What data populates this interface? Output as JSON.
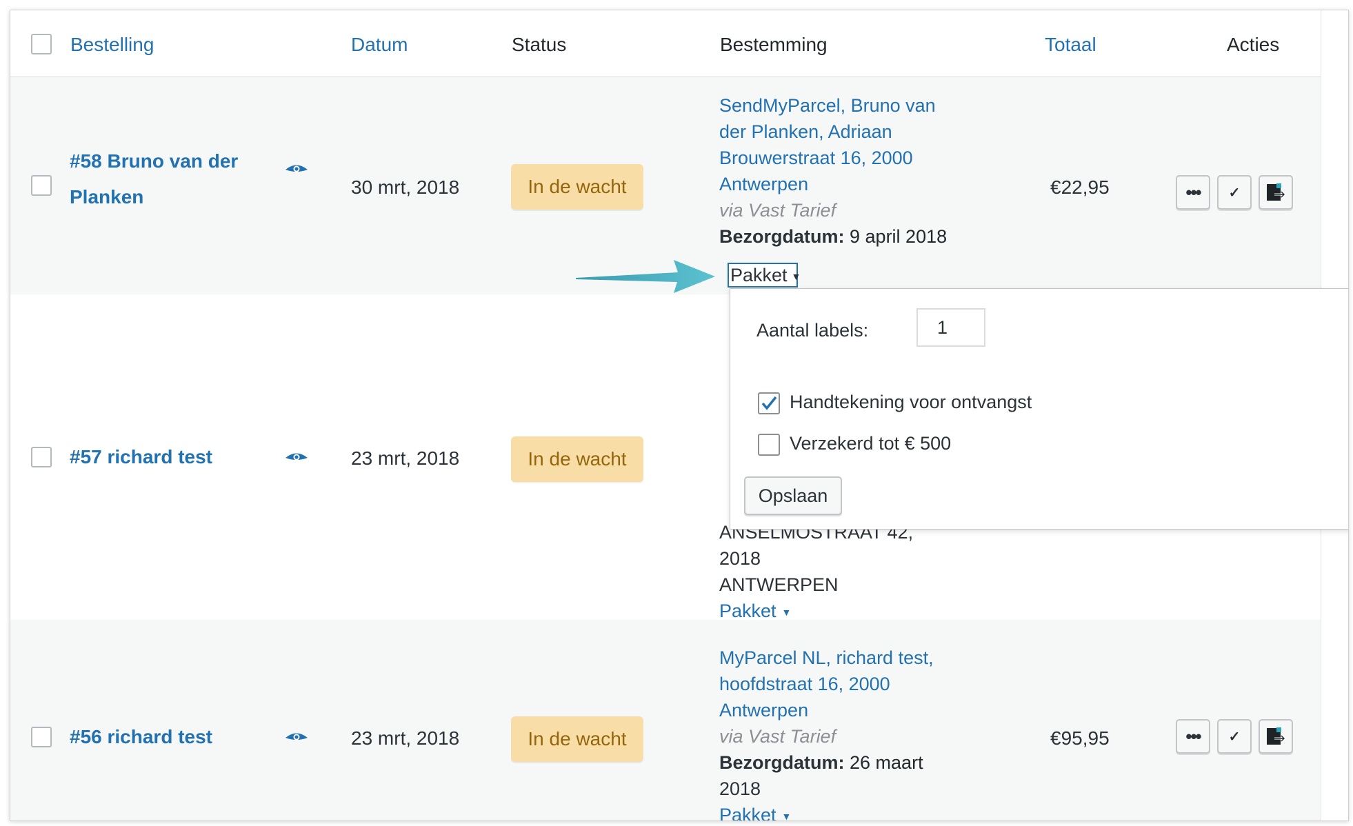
{
  "columns": {
    "order": "Bestelling",
    "date": "Datum",
    "status": "Status",
    "destination": "Bestemming",
    "total": "Totaal",
    "actions": "Acties"
  },
  "orders": [
    {
      "name_line1": "#58 Bruno van der",
      "name_line2": "Planken",
      "date": "30 mrt, 2018",
      "status": "In de wacht",
      "address_lines": [
        "SendMyParcel, Bruno van",
        "der Planken, Adriaan",
        "Brouwerstraat 16, 2000",
        "Antwerpen"
      ],
      "shipping_method": "via Vast Tarief",
      "delivery_label": "Bezorgdatum:",
      "delivery_date": "9 april 2018",
      "package_type": "Pakket",
      "total": "€22,95"
    },
    {
      "name": "#57 richard test",
      "date": "23 mrt, 2018",
      "status": "In de wacht",
      "address_lines": [
        "ANSELMOSTRAAT 42, 2018",
        "ANTWERPEN"
      ],
      "package_type": "Pakket"
    },
    {
      "name": "#56 richard test",
      "date": "23 mrt, 2018",
      "status": "In de wacht",
      "address_lines": [
        "MyParcel NL, richard test,",
        "hoofdstraat 16, 2000",
        "Antwerpen"
      ],
      "shipping_method": "via Vast Tarief",
      "delivery_label": "Bezorgdatum:",
      "delivery_date_line1": "26 maart",
      "delivery_date_line2": "2018",
      "package_type": "Pakket",
      "total": "€95,95"
    }
  ],
  "popup": {
    "labels_count_label": "Aantal labels:",
    "labels_count_value": "1",
    "option_signature": "Handtekening voor ontvangst",
    "option_signature_checked": true,
    "option_insured": "Verzekerd tot € 500",
    "option_insured_checked": false,
    "save_button": "Opslaan"
  },
  "icons": {
    "view": "eye-icon",
    "more": "more-dots-icon",
    "complete": "checkmark-icon",
    "export": "export-label-icon",
    "pointer": "arrow-annotation"
  },
  "colors": {
    "link": "#2271b1",
    "status_bg": "#f8dda7",
    "status_text": "#94660c",
    "arrow": "#4fb3c4"
  }
}
